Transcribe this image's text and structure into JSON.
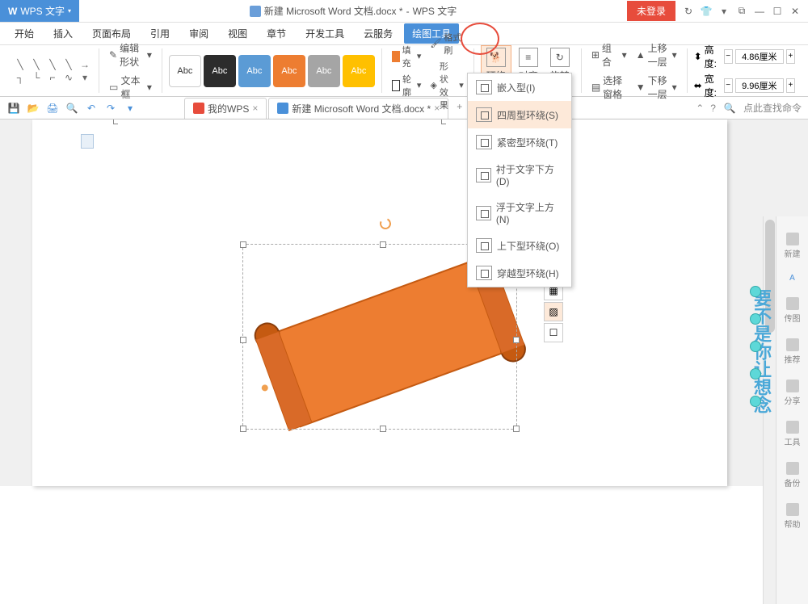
{
  "title": {
    "app": "WPS 文字",
    "doc": "新建 Microsoft Word 文档.docx *",
    "suffix": "WPS 文字"
  },
  "login_badge": "未登录",
  "menus": [
    "开始",
    "插入",
    "页面布局",
    "引用",
    "审阅",
    "视图",
    "章节",
    "开发工具",
    "云服务",
    "绘图工具"
  ],
  "ribbon": {
    "edit_shape": "编辑形状",
    "text_box": "文本框",
    "abc": "Abc",
    "fill": "填充",
    "outline": "轮廓",
    "format_painter": "格式刷",
    "shape_effects": "形状效果",
    "wrap": "环绕",
    "align": "对齐",
    "rotate": "旋转",
    "group": "组合",
    "select_pane": "选择窗格",
    "bring_forward": "上移一层",
    "send_backward": "下移一层",
    "height": "高度:",
    "width": "宽度:",
    "height_val": "4.86厘米",
    "width_val": "9.96厘米"
  },
  "tabs": {
    "my_wps": "我的WPS",
    "doc": "新建 Microsoft Word 文档.docx *"
  },
  "search_placeholder": "点此查找命令",
  "wrap_options": [
    {
      "label": "嵌入型(I)"
    },
    {
      "label": "四周型环绕(S)"
    },
    {
      "label": "紧密型环绕(T)"
    },
    {
      "label": "衬于文字下方(D)"
    },
    {
      "label": "浮于文字上方(N)"
    },
    {
      "label": "上下型环绕(O)"
    },
    {
      "label": "穿越型环绕(H)"
    }
  ],
  "right_panel": [
    "新建",
    "传图",
    "推荐",
    "分享",
    "工具",
    "备份",
    "帮助"
  ],
  "watermark": "要不是你让想念"
}
